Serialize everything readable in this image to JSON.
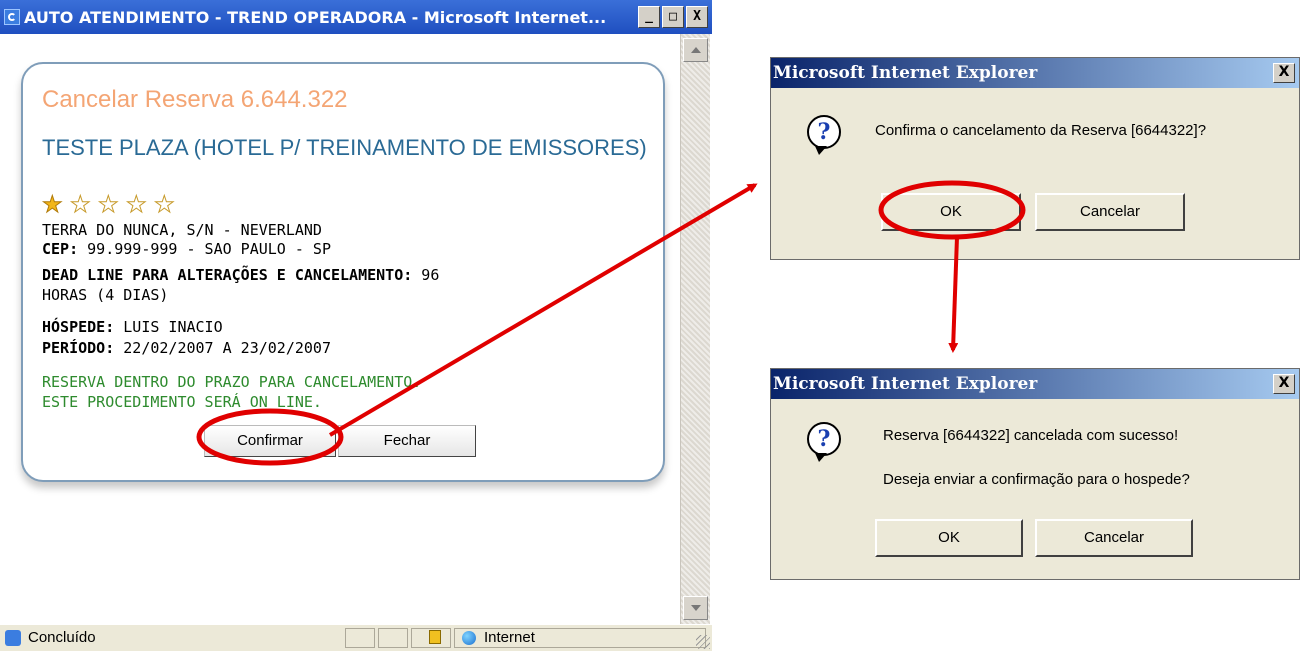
{
  "ie_window": {
    "title": "AUTO ATENDIMENTO - TREND OPERADORA - Microsoft Internet...",
    "buttons": {
      "minimize": "_",
      "maximize": "□",
      "close": "X"
    }
  },
  "reservation": {
    "title": "Cancelar Reserva 6.644.322",
    "hotel_name": "TESTE PLAZA (HOTEL P/ TREINAMENTO DE EMISSORES)",
    "stars_total": 5,
    "stars_filled": 1,
    "address": "TERRA DO NUNCA, S/N - NEVERLAND",
    "cep_label": "CEP:",
    "cep_value": " 99.999-999 - SAO PAULO - SP",
    "deadline_label": "DEAD LINE PARA ALTERAÇÕES E CANCELAMENTO:",
    "deadline_value": " 96",
    "deadline_value_cont": "HORAS (4 DIAS)",
    "guest_label": "HÓSPEDE:",
    "guest_value": " LUIS INACIO",
    "period_label": "PERÍODO:",
    "period_value": " 22/02/2007 A 23/02/2007",
    "notice_line1": "RESERVA DENTRO DO PRAZO PARA CANCELAMENTO.",
    "notice_line2": "ESTE PROCEDIMENTO SERÁ ON LINE.",
    "confirm_label": "Confirmar",
    "close_label": "Fechar"
  },
  "status_bar": {
    "text": "Concluído",
    "zone": "Internet"
  },
  "dialog1": {
    "title": "Microsoft Internet Explorer",
    "close": "X",
    "message": "Confirma o cancelamento da Reserva [6644322]?",
    "ok_label": "OK",
    "cancel_label": "Cancelar"
  },
  "dialog2": {
    "title": "Microsoft Internet Explorer",
    "close": "X",
    "message1": "Reserva [6644322] cancelada com sucesso!",
    "message2": "Deseja enviar a confirmação para o hospede?",
    "ok_label": "OK",
    "cancel_label": "Cancelar"
  },
  "colors": {
    "annotation_red": "#e00000",
    "title_orange": "#f4a574",
    "hotel_blue": "#2a6a95",
    "notice_green": "#2e8b2e"
  }
}
